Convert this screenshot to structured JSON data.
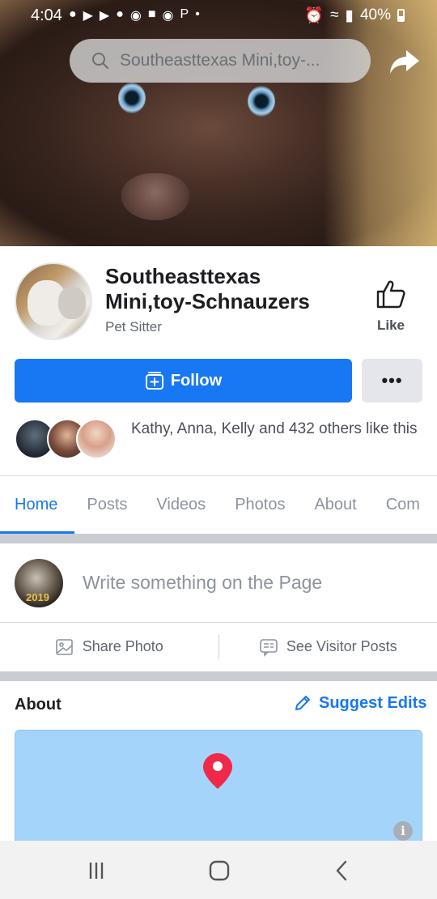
{
  "status_bar": {
    "time": "4:04",
    "battery": "40%",
    "left_icons": [
      "facebook-icon",
      "youtube-icon",
      "youtube-icon",
      "messenger-icon",
      "pet-icon",
      "badge-icon",
      "account-icon",
      "pinterest-icon",
      "dot-icon"
    ],
    "right_icons": [
      "alarm-icon",
      "wifi-icon",
      "signal-icon",
      "battery-icon"
    ]
  },
  "search": {
    "text": "Southeasttexas Mini,toy-..."
  },
  "page": {
    "name": "Southeasttexas Mini,toy-Schnauzers",
    "category": "Pet Sitter",
    "like_label": "Like",
    "follow_label": "Follow",
    "more_label": "•••",
    "likes_text": "Kathy, Anna, Kelly and 432 others like this"
  },
  "tabs": [
    {
      "label": "Home",
      "active": true
    },
    {
      "label": "Posts",
      "active": false
    },
    {
      "label": "Videos",
      "active": false
    },
    {
      "label": "Photos",
      "active": false
    },
    {
      "label": "About",
      "active": false
    },
    {
      "label": "Com",
      "active": false
    }
  ],
  "composer": {
    "placeholder": "Write something on the Page",
    "avatar_year": "2019",
    "share_photo": "Share Photo",
    "see_visitor_posts": "See Visitor Posts"
  },
  "about": {
    "title": "About",
    "suggest_edits": "Suggest Edits",
    "info_badge": "i"
  },
  "colors": {
    "accent": "#1877f2",
    "map": "#a5d4fb",
    "pin": "#f02849"
  }
}
